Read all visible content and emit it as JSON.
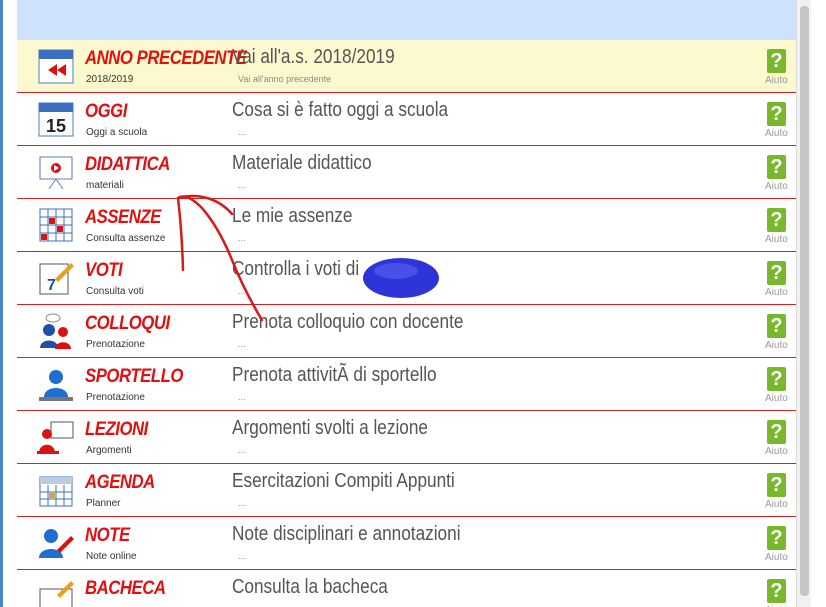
{
  "help_label": "Aiuto",
  "help_symbol": "?",
  "accent_color": "#e01010",
  "highlight_color": "#fcf9cf",
  "rows": [
    {
      "title": "ANNO PRECEDENTE",
      "subtitle": "2018/2019",
      "desc": "Vai all'a.s. 2018/2019",
      "subdesc": "Vai all'anno precedente",
      "icon": "calendar-back-icon",
      "highlight": true
    },
    {
      "title": "OGGI",
      "subtitle": "Oggi a scuola",
      "desc": "Cosa si è fatto oggi a scuola",
      "subdesc": "...",
      "icon": "calendar-15-icon"
    },
    {
      "title": "DIDATTICA",
      "subtitle": "materiali",
      "desc": "Materiale didattico",
      "subdesc": "...",
      "icon": "presentation-board-icon"
    },
    {
      "title": "ASSENZE",
      "subtitle": "Consulta assenze",
      "desc": "Le mie assenze",
      "subdesc": "...",
      "icon": "absence-grid-icon"
    },
    {
      "title": "VOTI",
      "subtitle": "Consulta voti",
      "desc": "Controlla i voti di",
      "subdesc": "...",
      "icon": "grade-pencil-icon"
    },
    {
      "title": "COLLOQUI",
      "subtitle": "Prenotazione",
      "desc": "Prenota colloquio con docente",
      "subdesc": "...",
      "icon": "conversation-icon"
    },
    {
      "title": "SPORTELLO",
      "subtitle": "Prenotazione",
      "desc": "Prenota attivitÃ  di sportello",
      "subdesc": "...",
      "icon": "help-desk-icon"
    },
    {
      "title": "LEZIONI",
      "subtitle": "Argomenti",
      "desc": "Argomenti svolti a lezione",
      "subdesc": "...",
      "icon": "teacher-board-icon"
    },
    {
      "title": "AGENDA",
      "subtitle": "Planner",
      "desc": "Esercitazioni Compiti Appunti",
      "subdesc": "...",
      "icon": "planner-icon"
    },
    {
      "title": "NOTE",
      "subtitle": "Note online",
      "desc": "Note disciplinari e annotazioni",
      "subdesc": "...",
      "icon": "notes-pencil-icon"
    },
    {
      "title": "BACHECA",
      "subtitle": "",
      "desc": "Consulta la bacheca",
      "subdesc": "",
      "icon": "noticeboard-icon"
    }
  ]
}
